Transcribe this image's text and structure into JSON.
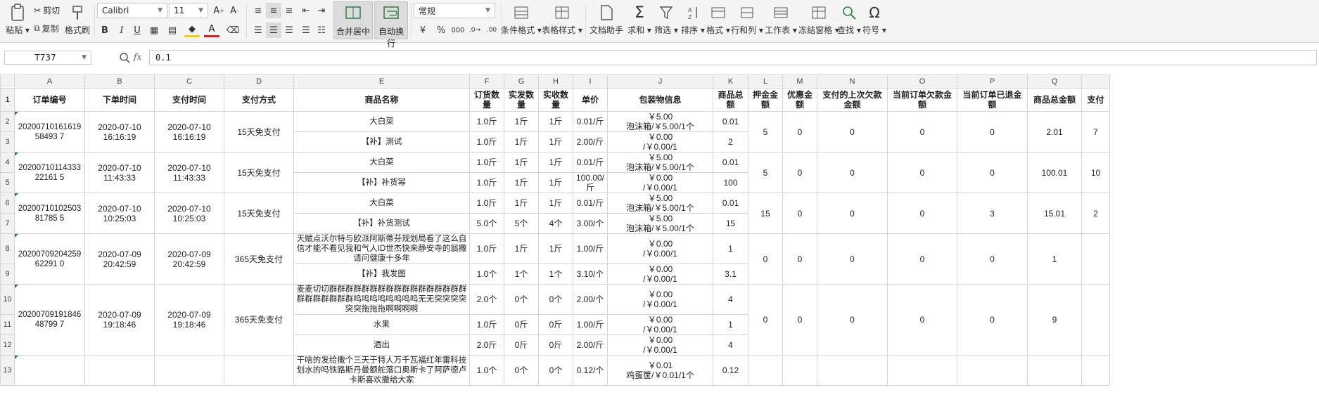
{
  "ribbon": {
    "paste": "粘贴",
    "cut": "剪切",
    "copy": "复制",
    "format_painter": "格式刷",
    "font_name": "Calibri",
    "font_size": "11",
    "merge_center": "合并居中",
    "wrap_text": "自动换行",
    "number_format": "常规",
    "conditional_format": "条件格式",
    "table_style": "表格样式",
    "doc_assistant": "文档助手",
    "sum": "求和",
    "filter": "筛选",
    "sort": "排序",
    "format": "格式",
    "rows_cols": "行和列",
    "worksheet": "工作表",
    "freeze": "冻结窗格",
    "find": "查找",
    "symbol": "符号"
  },
  "formula_bar": {
    "cell_ref": "T737",
    "fx": "fx",
    "value": "0.1"
  },
  "columns": [
    "A",
    "B",
    "C",
    "D",
    "E",
    "F",
    "G",
    "H",
    "I",
    "J",
    "K",
    "L",
    "M",
    "N",
    "O",
    "P",
    "Q",
    ""
  ],
  "headers": [
    "订单编号",
    "下单时间",
    "支付时间",
    "支付方式",
    "商品名称",
    "订货数量",
    "实发数量",
    "实收数量",
    "单价",
    "包装物信息",
    "商品总额",
    "押金金额",
    "优惠金额",
    "支付的上次欠款金额",
    "当前订单欠款金额",
    "当前订单已退金额",
    "商品总金额",
    "支付"
  ],
  "orders": [
    {
      "id": "202007101616195849 37",
      "id_disp": "2020071016161958493 7",
      "order_time": "2020-07-10 16:16:19",
      "pay_time": "2020-07-10 16:16:19",
      "pay_method": "15天免支付",
      "deposit": "5",
      "discount": "0",
      "prev_debt": "0",
      "cur_debt": "0",
      "refunded": "0",
      "total": "2.01",
      "pay": "7",
      "items": [
        {
          "row": "2",
          "name": "大白菜",
          "qty": "1.0斤",
          "sent": "1斤",
          "recv": "1斤",
          "price": "0.01/斤",
          "pack1": "￥5.00",
          "pack2": "泡沫箱/￥5.00/1个",
          "amount": "0.01"
        },
        {
          "row": "3",
          "name": "【补】测试",
          "qty": "1.0斤",
          "sent": "1斤",
          "recv": "1斤",
          "price": "2.00/斤",
          "pack1": "￥0.00",
          "pack2": "/￥0.00/1",
          "amount": "2"
        }
      ]
    },
    {
      "id_disp": "2020071011433322161 5",
      "order_time": "2020-07-10 11:43:33",
      "pay_time": "2020-07-10 11:43:33",
      "pay_method": "15天免支付",
      "deposit": "5",
      "discount": "0",
      "prev_debt": "0",
      "cur_debt": "0",
      "refunded": "0",
      "total": "100.01",
      "pay": "10",
      "items": [
        {
          "row": "4",
          "name": "大白菜",
          "qty": "1.0斤",
          "sent": "1斤",
          "recv": "1斤",
          "price": "0.01/斤",
          "pack1": "￥5.00",
          "pack2": "泡沫箱/￥5.00/1个",
          "amount": "0.01"
        },
        {
          "row": "5",
          "name": "【补】补货幂",
          "qty": "1.0斤",
          "sent": "1斤",
          "recv": "1斤",
          "price": "100.00/斤",
          "pack1": "￥0.00",
          "pack2": "/￥0.00/1",
          "amount": "100"
        }
      ]
    },
    {
      "id_disp": "2020071010250381785 5",
      "order_time": "2020-07-10 10:25:03",
      "pay_time": "2020-07-10 10:25:03",
      "pay_method": "15天免支付",
      "deposit": "15",
      "discount": "0",
      "prev_debt": "0",
      "cur_debt": "0",
      "refunded": "3",
      "total": "15.01",
      "pay": "2",
      "items": [
        {
          "row": "6",
          "name": "大白菜",
          "qty": "1.0斤",
          "sent": "1斤",
          "recv": "1斤",
          "price": "0.01/斤",
          "pack1": "￥5.00",
          "pack2": "泡沫箱/￥5.00/1个",
          "amount": "0.01"
        },
        {
          "row": "7",
          "name": "【补】补货测试",
          "qty": "5.0个",
          "sent": "5个",
          "recv": "4个",
          "price": "3.00/个",
          "pack1": "￥5.00",
          "pack2": "泡沫箱/￥5.00/1个",
          "amount": "15"
        }
      ]
    },
    {
      "id_disp": "2020070920425962291 0",
      "order_time": "2020-07-09 20:42:59",
      "pay_time": "2020-07-09 20:42:59",
      "pay_method": "365天免支付",
      "deposit": "0",
      "discount": "0",
      "prev_debt": "0",
      "cur_debt": "0",
      "refunded": "0",
      "total": "1",
      "pay": "",
      "items": [
        {
          "row": "8",
          "name": "天赋点沃尔特与欧派阿斯蒂芬规划局看了这么自信才能不看见我和气人ID世杰快来静安寺的翁撒请问健康十多年",
          "qty": "1.0斤",
          "sent": "1斤",
          "recv": "1斤",
          "price": "1.00/斤",
          "pack1": "￥0.00",
          "pack2": "/￥0.00/1",
          "amount": "1"
        },
        {
          "row": "9",
          "name": "【补】我发图",
          "qty": "1.0个",
          "sent": "1个",
          "recv": "1个",
          "price": "3.10/个",
          "pack1": "￥0.00",
          "pack2": "/￥0.00/1",
          "amount": "3.1"
        }
      ]
    },
    {
      "id_disp": "2020070919184648799 7",
      "order_time": "2020-07-09 19:18:46",
      "pay_time": "2020-07-09 19:18:46",
      "pay_method": "365天免支付",
      "deposit": "0",
      "discount": "0",
      "prev_debt": "0",
      "cur_debt": "0",
      "refunded": "0",
      "total": "9",
      "pay": "",
      "items": [
        {
          "row": "10",
          "name": "麦麦切切群群群群群群群群群群群群群群群群群群群群群群群群呜呜呜呜呜呜呜呜无无突突突突突突拖拖拖啊啊啊啊",
          "qty": "2.0个",
          "sent": "0个",
          "recv": "0个",
          "price": "2.00/个",
          "pack1": "￥0.00",
          "pack2": "/￥0.00/1",
          "amount": "4"
        },
        {
          "row": "11",
          "name": "水果",
          "qty": "1.0斤",
          "sent": "0斤",
          "recv": "0斤",
          "price": "1.00/斤",
          "pack1": "￥0.00",
          "pack2": "/￥0.00/1",
          "amount": "1"
        },
        {
          "row": "12",
          "name": "酒出",
          "qty": "2.0斤",
          "sent": "0斤",
          "recv": "0斤",
          "price": "2.00/斤",
          "pack1": "￥0.00",
          "pack2": "/￥0.00/1",
          "amount": "4"
        }
      ]
    },
    {
      "id_disp": "",
      "order_time": "",
      "pay_time": "",
      "pay_method": "",
      "deposit": "",
      "discount": "",
      "prev_debt": "",
      "cur_debt": "",
      "refunded": "",
      "total": "",
      "pay": "",
      "items": [
        {
          "row": "13",
          "name": "干啥的发给撒个三天于特人万千瓦福红年雷科技划水的吗铁路斯丹曼额舵落口奥斯卡了阿萨德卢卡斯喜欢撒给大家",
          "qty": "1.0个",
          "sent": "0个",
          "recv": "0个",
          "price": "0.12/个",
          "pack1": "￥0.01",
          "pack2": "鸡蛋筐/￥0.01/1个",
          "amount": "0.12"
        }
      ]
    }
  ]
}
